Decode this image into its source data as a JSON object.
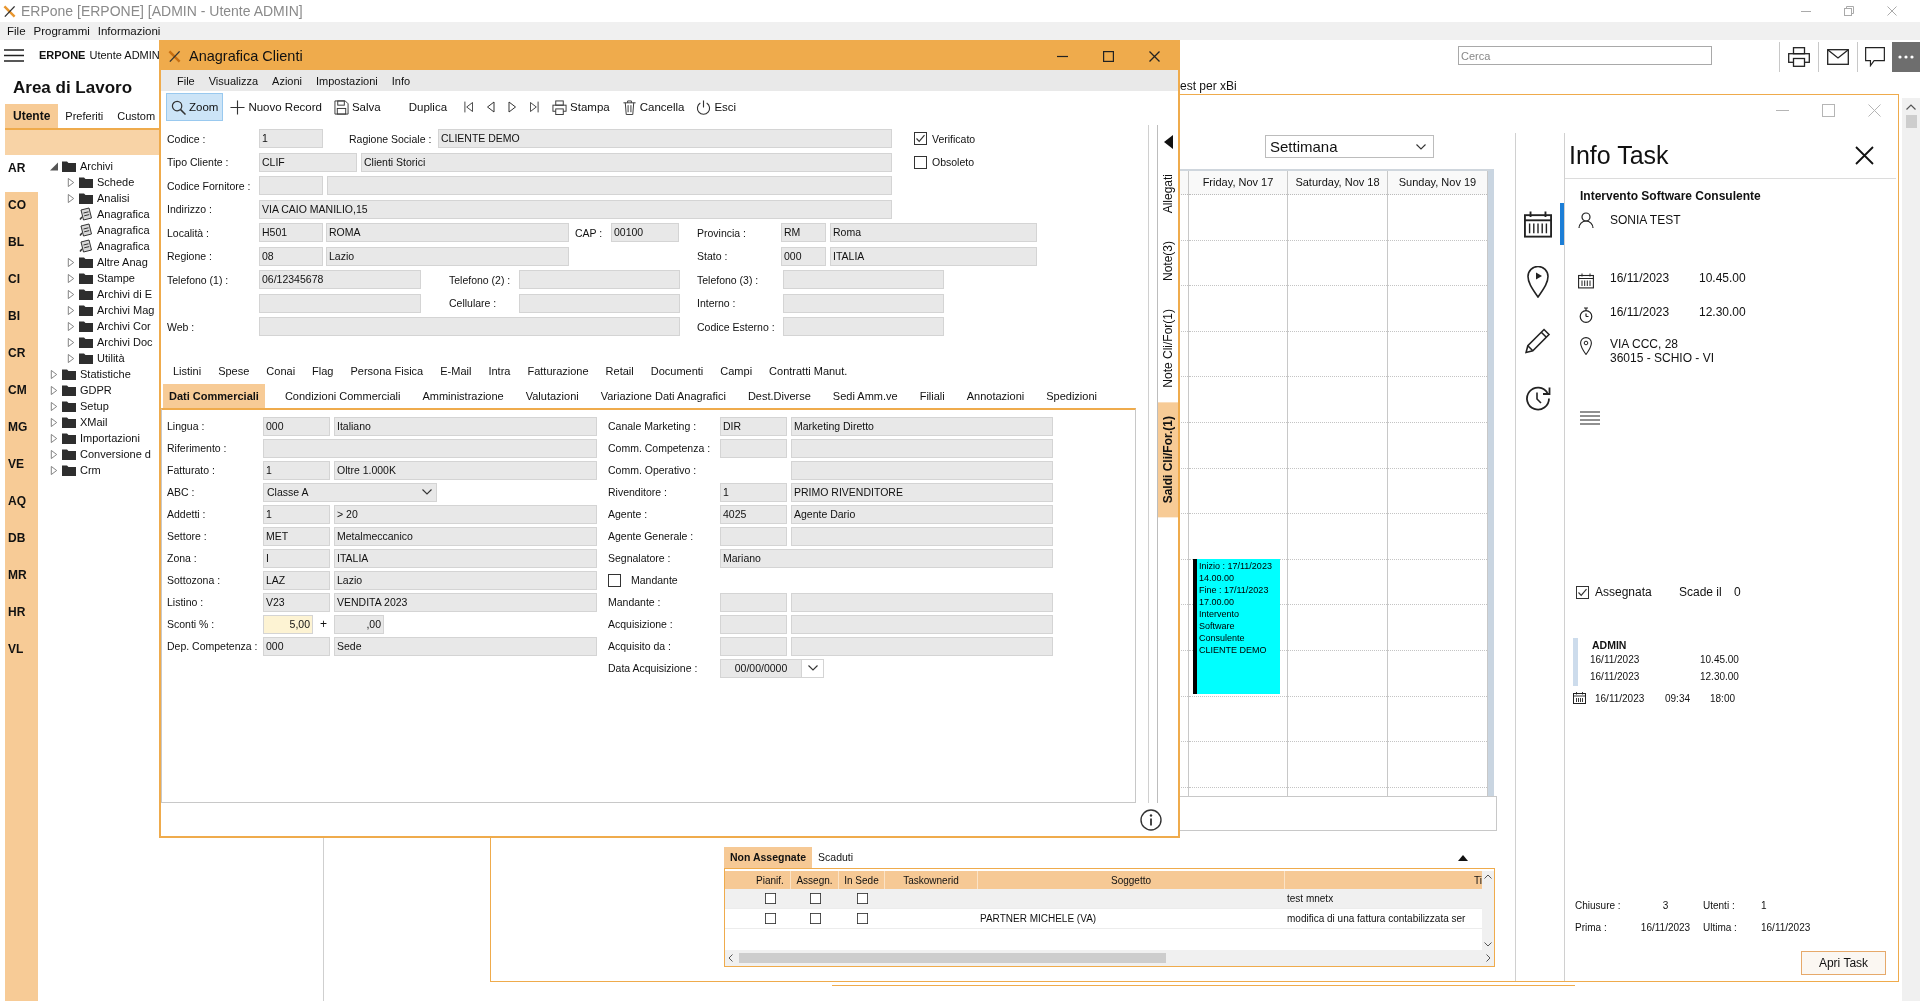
{
  "app_window": {
    "title": "ERPone [ERPONE] [ADMIN - Utente ADMIN]"
  },
  "menu_bar": [
    {
      "label": "File"
    },
    {
      "label": "Programmi"
    },
    {
      "label": "Informazioni"
    }
  ],
  "header": {
    "brand": "ERPONE",
    "user": "Utente ADMIN",
    "search": {
      "placeholder": "Cerca"
    }
  },
  "workspace": {
    "title": "Area di Lavoro",
    "tabs": [
      {
        "label": "Utente",
        "selected": true
      },
      {
        "label": "Preferiti",
        "selected": false
      },
      {
        "label": "Custom",
        "selected": false
      }
    ],
    "modules": [
      {
        "label": "AR",
        "selected": true
      },
      {
        "label": "CO",
        "selected": false
      },
      {
        "label": "BL",
        "selected": false
      },
      {
        "label": "CI",
        "selected": false
      },
      {
        "label": "BI",
        "selected": false
      },
      {
        "label": "CR",
        "selected": false
      },
      {
        "label": "CM",
        "selected": false
      },
      {
        "label": "MG",
        "selected": false
      },
      {
        "label": "VE",
        "selected": false
      },
      {
        "label": "AQ",
        "selected": false
      },
      {
        "label": "DB",
        "selected": false
      },
      {
        "label": "MR",
        "selected": false
      },
      {
        "label": "HR",
        "selected": false
      },
      {
        "label": "VL",
        "selected": false
      }
    ],
    "tree": [
      {
        "label": "Archivi",
        "kind": "folder",
        "expanded": true,
        "children": [
          {
            "label": "Schede",
            "kind": "folder",
            "expanded": false
          },
          {
            "label": "Analisi",
            "kind": "folder",
            "expanded": false
          },
          {
            "label": "Anagrafica",
            "kind": "document"
          },
          {
            "label": "Anagrafica",
            "kind": "document"
          },
          {
            "label": "Anagrafica",
            "kind": "document"
          },
          {
            "label": "Altre Anag",
            "kind": "folder",
            "expanded": false
          },
          {
            "label": "Stampe",
            "kind": "folder",
            "expanded": false
          },
          {
            "label": "Archivi di E",
            "kind": "folder",
            "expanded": false
          },
          {
            "label": "Archivi Mag",
            "kind": "folder",
            "expanded": false
          },
          {
            "label": "Archivi Cor",
            "kind": "folder",
            "expanded": false
          },
          {
            "label": "Archivi Doc",
            "kind": "folder",
            "expanded": false
          },
          {
            "label": "Utilità",
            "kind": "folder",
            "expanded": false
          }
        ]
      },
      {
        "label": "Statistiche",
        "kind": "folder",
        "expanded": false
      },
      {
        "label": "GDPR",
        "kind": "folder",
        "expanded": false
      },
      {
        "label": "Setup",
        "kind": "folder",
        "expanded": false
      },
      {
        "label": "XMail",
        "kind": "folder",
        "expanded": false
      },
      {
        "label": "Importazioni",
        "kind": "folder",
        "expanded": false
      },
      {
        "label": "Conversione d",
        "kind": "folder",
        "expanded": false
      },
      {
        "label": "Crm",
        "kind": "folder",
        "expanded": false
      }
    ]
  },
  "document_tabs": [
    {
      "label": "est per xBi"
    }
  ],
  "dialog": {
    "title": "Anagrafica Clienti",
    "menu": [
      {
        "label": "File"
      },
      {
        "label": "Visualizza"
      },
      {
        "label": "Azioni"
      },
      {
        "label": "Impostazioni"
      },
      {
        "label": "Info"
      }
    ],
    "toolbar": [
      {
        "label": "Zoom",
        "selected": true
      },
      {
        "label": "Nuovo Record",
        "selected": false
      },
      {
        "label": "Salva",
        "selected": false
      },
      {
        "label": "Duplica",
        "selected": false
      },
      {
        "label": "Stampa",
        "selected": false
      },
      {
        "label": "Cancella",
        "selected": false
      },
      {
        "label": "Esci",
        "selected": false
      }
    ],
    "form": {
      "codice": {
        "label": "Codice :",
        "value": "1"
      },
      "ragione_sociale": {
        "label": "Ragione Sociale :",
        "value": "CLIENTE DEMO"
      },
      "verificato": {
        "label": "Verificato",
        "checked": true
      },
      "tipo_cliente": {
        "label": "Tipo Cliente :",
        "code": "CLIF",
        "description": "Clienti Storici"
      },
      "obsoleto": {
        "label": "Obsoleto",
        "checked": false
      },
      "codice_fornitore": {
        "label": "Codice Fornitore :"
      },
      "indirizzo": {
        "label": "Indirizzo :",
        "value": "VIA CAIO MANILIO,15"
      },
      "localita": {
        "label": "Località :",
        "code": "H501",
        "description": "ROMA"
      },
      "cap": {
        "label": "CAP :",
        "value": "00100"
      },
      "provincia": {
        "label": "Provincia :",
        "code": "RM",
        "description": "Roma"
      },
      "regione": {
        "label": "Regione :",
        "code": "08",
        "description": "Lazio"
      },
      "stato": {
        "label": "Stato :",
        "code": "000",
        "description": "ITALIA"
      },
      "telefono_1": {
        "label": "Telefono (1) :",
        "value": "06/12345678"
      },
      "telefono_2": {
        "label": "Telefono (2) :"
      },
      "telefono_3": {
        "label": "Telefono (3) :"
      },
      "cellulare": {
        "label": "Cellulare :"
      },
      "interno": {
        "label": "Interno :"
      },
      "web": {
        "label": "Web :"
      },
      "codice_esterno": {
        "label": "Codice Esterno :"
      }
    },
    "tabs_row_1": [
      {
        "label": "Listini",
        "selected": false
      },
      {
        "label": "Spese",
        "selected": false
      },
      {
        "label": "Conai",
        "selected": false
      },
      {
        "label": "Flag",
        "selected": false
      },
      {
        "label": "Persona Fisica",
        "selected": false
      },
      {
        "label": "E-Mail",
        "selected": false
      },
      {
        "label": "Intra",
        "selected": false
      },
      {
        "label": "Fatturazione",
        "selected": false
      },
      {
        "label": "Retail",
        "selected": false
      },
      {
        "label": "Documenti",
        "selected": false
      },
      {
        "label": "Campi",
        "selected": false
      },
      {
        "label": "Contratti Manut.",
        "selected": false
      }
    ],
    "tabs_row_2": [
      {
        "label": "Dati Commerciali",
        "selected": true
      },
      {
        "label": "Condizioni Commerciali",
        "selected": false
      },
      {
        "label": "Amministrazione",
        "selected": false
      },
      {
        "label": "Valutazioni",
        "selected": false
      },
      {
        "label": "Variazione Dati Anagrafici",
        "selected": false
      },
      {
        "label": "Dest.Diverse",
        "selected": false
      },
      {
        "label": "Sedi Amm.ve",
        "selected": false
      },
      {
        "label": "Filiali",
        "selected": false
      },
      {
        "label": "Annotazioni",
        "selected": false
      },
      {
        "label": "Spedizioni",
        "selected": false
      }
    ],
    "commercial": {
      "left": [
        {
          "kind": "code_desc",
          "label": "Lingua :",
          "code": "000",
          "description": "Italiano"
        },
        {
          "kind": "wide",
          "label": "Riferimento :"
        },
        {
          "kind": "code_desc",
          "label": "Fatturato :",
          "code": "1",
          "description": "Oltre 1.000K"
        },
        {
          "kind": "dropdown",
          "label": "ABC :",
          "value": "Classe A"
        },
        {
          "kind": "code_desc",
          "label": "Addetti :",
          "code": "1",
          "description": "> 20"
        },
        {
          "kind": "code_desc",
          "label": "Settore :",
          "code": "MET",
          "description": "Metalmeccanico"
        },
        {
          "kind": "code_desc",
          "label": "Zona :",
          "code": "I",
          "description": "ITALIA"
        },
        {
          "kind": "code_desc",
          "label": "Sottozona :",
          "code": "LAZ",
          "description": "Lazio"
        },
        {
          "kind": "code_desc",
          "label": "Listino :",
          "code": "V23",
          "description": "VENDITA 2023"
        },
        {
          "kind": "discount",
          "label": "Sconti % :",
          "value": "5,00",
          "operator": "+",
          "value_2": ",00"
        },
        {
          "kind": "code_desc",
          "label": "Dep. Competenza :",
          "code": "000",
          "description": "Sede"
        }
      ],
      "right": [
        {
          "kind": "code_desc",
          "label": "Canale Marketing :",
          "code": "DIR",
          "description": "Marketing Diretto"
        },
        {
          "kind": "code_desc",
          "label": "Comm. Competenza :"
        },
        {
          "kind": "desc_only",
          "label": "Comm. Operativo :"
        },
        {
          "kind": "code_desc",
          "label": "Rivenditore :",
          "code": "1",
          "description": "PRIMO RIVENDITORE"
        },
        {
          "kind": "code_desc",
          "label": "Agente :",
          "code": "4025",
          "description": "Agente Dario"
        },
        {
          "kind": "code_desc",
          "label": "Agente Generale :"
        },
        {
          "kind": "wide",
          "label": "Segnalatore :",
          "value": "Mariano"
        },
        {
          "kind": "checkbox",
          "label": "Mandante",
          "checked": false
        },
        {
          "kind": "code_desc",
          "label": "Mandante :"
        },
        {
          "kind": "code_desc",
          "label": "Acquisizione :"
        },
        {
          "kind": "code_desc",
          "label": "Acquisito da :"
        },
        {
          "kind": "date",
          "label": "Data Acquisizione :",
          "value": "00/00/0000"
        }
      ]
    },
    "side_tabs": [
      {
        "label": "Allegati",
        "selected": false
      },
      {
        "label": "Note(3)",
        "selected": false
      },
      {
        "label": "Note Cli/For(1)",
        "selected": false
      },
      {
        "label": "Saldi Cli/For.(1)",
        "selected": true
      }
    ]
  },
  "task_window": {
    "calendar": {
      "view": "Settimana",
      "days": [
        {
          "label": "Friday, Nov 17",
          "events": [
            {
              "color": "#00ffff",
              "lines": [
                "Inizio : 17/11/2023",
                "14.00.00",
                "Fine : 17/11/2023",
                "17.00.00",
                "Intervento",
                "Software",
                "Consulente",
                "CLIENTE DEMO"
              ]
            }
          ]
        },
        {
          "label": "Saturday, Nov 18"
        },
        {
          "label": "Sunday, Nov 19"
        }
      ]
    },
    "nav": [
      {
        "selected": true
      },
      {
        "selected": false
      },
      {
        "selected": false
      },
      {
        "selected": false
      }
    ],
    "info": {
      "title": "Info Task",
      "subject": "Intervento Software Consulente",
      "person": "SONIA TEST",
      "start": {
        "date": "16/11/2023",
        "time": "10.45.00"
      },
      "end": {
        "date": "16/11/2023",
        "time": "12.30.00"
      },
      "address": [
        "VIA CCC, 28",
        "36015 - SCHIO - VI"
      ],
      "assigned": {
        "label": "Assegnata",
        "checked": true
      },
      "due": {
        "label": "Scade il",
        "value": "0"
      },
      "assignee": {
        "name": "ADMIN",
        "start": {
          "date": "16/11/2023",
          "time": "10.45.00"
        },
        "end": {
          "date": "16/11/2023",
          "time": "12.30.00"
        },
        "log": {
          "date": "16/11/2023",
          "from": "09:34",
          "to": "18:00"
        }
      },
      "stats": [
        {
          "label": "Chiusure :",
          "value": "3"
        },
        {
          "label": "Utenti :",
          "value": "1"
        },
        {
          "label": "Prima :",
          "value": "16/11/2023"
        },
        {
          "label": "Ultima :",
          "value": "16/11/2023"
        }
      ],
      "open_button": "Apri Task"
    },
    "bottom": {
      "tabs": [
        {
          "label": "Non Assegnate",
          "selected": true
        },
        {
          "label": "Scaduti",
          "selected": false
        }
      ],
      "columns": [
        "Pianif.",
        "Assegn.",
        "In Sede",
        "Taskownerid",
        "Soggetto",
        "Ti"
      ],
      "rows": [
        {
          "pianif": false,
          "assegn": false,
          "in_sede": false,
          "column_7": "test mnetx"
        },
        {
          "pianif": false,
          "assegn": false,
          "in_sede": false,
          "soggetto": "PARTNER MICHELE (VA)",
          "column_7": "modifica di una fattura contabilizzata ser"
        }
      ]
    }
  }
}
